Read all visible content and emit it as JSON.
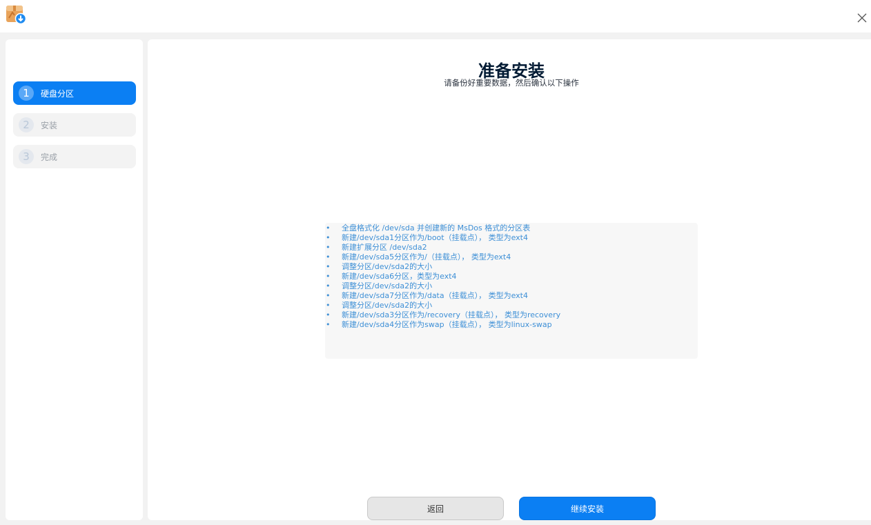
{
  "window": {
    "icon": "installer-package-icon",
    "close_icon": "close-icon"
  },
  "sidebar": {
    "steps": [
      {
        "number": "1",
        "label": "硬盘分区",
        "state": "active"
      },
      {
        "number": "2",
        "label": "安装",
        "state": "pending"
      },
      {
        "number": "3",
        "label": "完成",
        "state": "pending"
      }
    ]
  },
  "main": {
    "title": "准备安装",
    "subtitle": "请备份好重要数据，然后确认以下操作",
    "bullet": "•",
    "operations": [
      "全盘格式化  /dev/sda  并创建新的  MsDos  格式的分区表",
      "新建/dev/sda1分区作为/boot（挂载点），  类型为ext4",
      "新建扩展分区  /dev/sda2",
      "新建/dev/sda5分区作为/（挂载点），  类型为ext4",
      "调整分区/dev/sda2的大小",
      "新建/dev/sda6分区，类型为ext4",
      "调整分区/dev/sda2的大小",
      "新建/dev/sda7分区作为/data（挂载点），  类型为ext4",
      "调整分区/dev/sda2的大小",
      "新建/dev/sda3分区作为/recovery（挂载点），  类型为recovery",
      "新建/dev/sda4分区作为swap（挂载点），  类型为linux-swap"
    ],
    "back_label": "返回",
    "continue_label": "继续安装"
  },
  "colors": {
    "accent": "#0b7ff3",
    "operation_text": "#3d8fd6",
    "title_text": "#001a33"
  }
}
